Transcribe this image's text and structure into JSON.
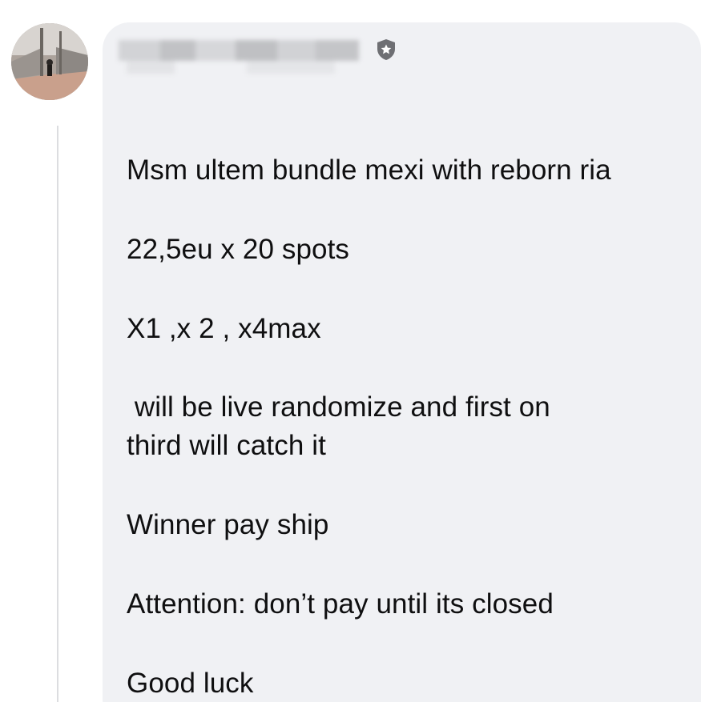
{
  "post": {
    "author": {
      "name": "",
      "avatar": "profile-photo",
      "badge": "admin-shield-icon"
    },
    "lines": [
      "Msm ultem bundle mexi with reborn ria",
      "22,5eu x 20 spots",
      "X1 ,x 2 , x4max",
      " will be live randomize and first on",
      "third will catch it",
      "Winner pay ship",
      "Attention: don’t pay until its closed",
      "Good luck"
    ]
  },
  "colors": {
    "bubble_background": "#f0f1f4",
    "text": "#0f0f10",
    "thread_line": "#dcdde0",
    "badge": "#6e6f73"
  }
}
